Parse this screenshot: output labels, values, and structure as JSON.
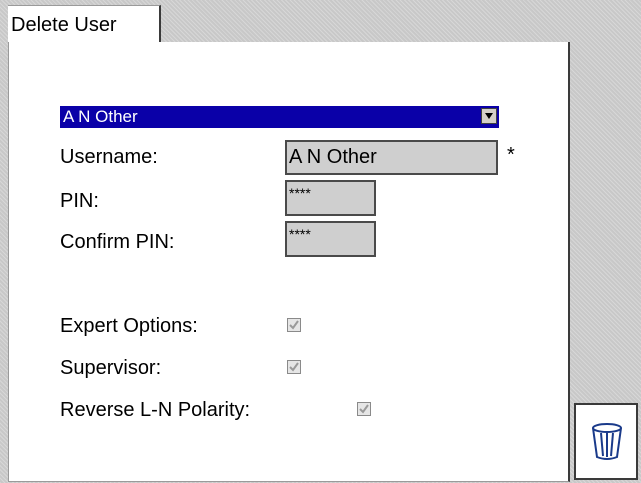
{
  "tab": {
    "label": "Delete User"
  },
  "user_select": {
    "selected": "A N Other"
  },
  "form": {
    "username_label": "Username:",
    "username_value": "A N Other",
    "required_marker": "*",
    "pin_label": "PIN:",
    "pin_value": "****",
    "confirm_pin_label": "Confirm PIN:",
    "confirm_pin_value": "****",
    "expert_options_label": "Expert Options:",
    "expert_options_checked": true,
    "supervisor_label": "Supervisor:",
    "supervisor_checked": true,
    "reverse_polarity_label": "Reverse L-N Polarity:",
    "reverse_polarity_checked": true
  },
  "actions": {
    "delete_icon": "trash-can-icon"
  },
  "colors": {
    "selection_bg": "#0a00a8",
    "field_bg": "#cfcfcf",
    "panel_bg": "#ffffff",
    "background": "#c8c8c8"
  }
}
